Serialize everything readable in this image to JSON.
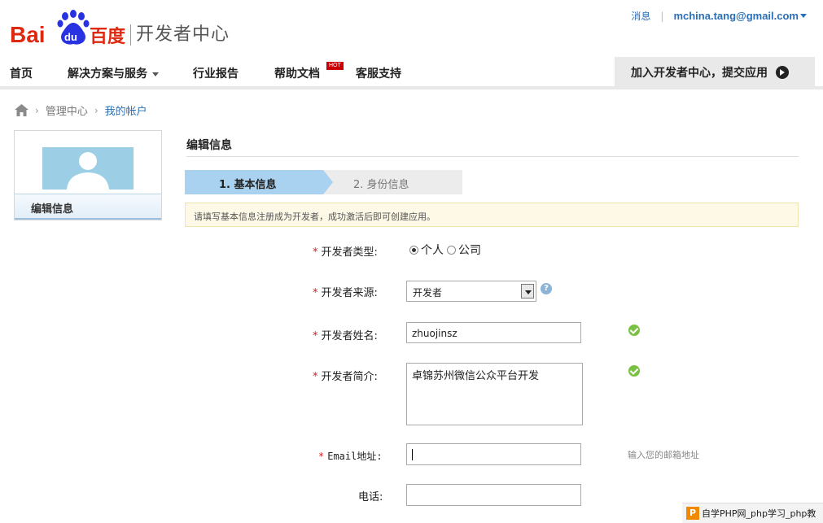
{
  "header": {
    "logo_text": "Bai du 百度",
    "subtitle": "开发者中心",
    "messages_link": "消息",
    "account_email": "mchina.tang@gmail.com"
  },
  "nav": {
    "items": [
      "首页",
      "解决方案与服务",
      "行业报告",
      "帮助文档",
      "客服支持"
    ],
    "hot_badge": "HOT",
    "join_button": "加入开发者中心，提交应用"
  },
  "breadcrumb": {
    "items": [
      "管理中心",
      "我的帐户"
    ]
  },
  "sidebar": {
    "tab_label": "编辑信息"
  },
  "main": {
    "section_title": "编辑信息",
    "steps": [
      "1. 基本信息",
      "2. 身份信息"
    ],
    "notice": "请填写基本信息注册成为开发者，成功激活后即可创建应用。"
  },
  "form": {
    "required_mark": "*",
    "type_label": "开发者类型:",
    "type_options": [
      "个人",
      "公司"
    ],
    "type_selected": "个人",
    "source_label": "开发者来源:",
    "source_value": "开发者",
    "help_glyph": "?",
    "name_label": "开发者姓名:",
    "name_value": "zhuojinsz",
    "intro_label": "开发者简介:",
    "intro_value": "卓锦苏州微信公众平台开发",
    "email_label": "Email地址:",
    "email_value": "",
    "email_hint": "输入您的邮箱地址",
    "phone_label": "电话:",
    "phone_value": ""
  },
  "watermark": {
    "icon_text": "P",
    "text": "自学PHP网_php学习_php教"
  },
  "colors": {
    "brand_red": "#de2910",
    "brand_blue": "#2932e1",
    "link_blue": "#2a6fb5",
    "step_active": "#a9d2f1",
    "notice_bg": "#fdf9e6",
    "ok_green": "#7ac143"
  }
}
